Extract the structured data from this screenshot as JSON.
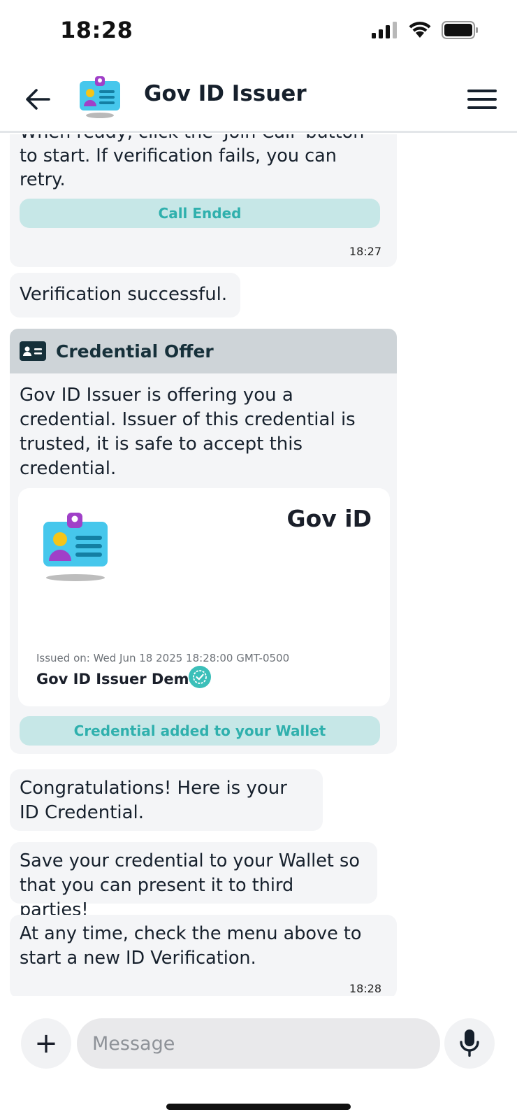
{
  "status_bar": {
    "time": "18:28",
    "icons": [
      "cellular-signal-icon",
      "wifi-icon",
      "battery-icon"
    ]
  },
  "header": {
    "title": "Gov ID Issuer",
    "back_icon": "arrow-left-icon",
    "menu_icon": "hamburger-menu-icon",
    "avatar_icon": "id-card-icon"
  },
  "messages": {
    "join_call": {
      "text": "When ready, click the 'Join Call' button to start. If verification fails, you can retry.",
      "status": "Call Ended",
      "time": "18:27"
    },
    "verification": {
      "text": "Verification successful."
    },
    "credential_offer": {
      "header": "Credential Offer",
      "text": "Gov ID Issuer is offering you a credential. Issuer of this credential is trusted, it is safe to accept this credential.",
      "card": {
        "name": "Gov iD",
        "issued_on": "Issued on: Wed Jun 18 2025 18:28:00 GMT-0500",
        "issuer": "Gov ID Issuer Demo"
      },
      "status": "Credential added to your Wallet"
    },
    "congrats": {
      "text": "Congratulations! Here is your ID Credential."
    },
    "save": {
      "text": "Save your credential to your Wallet so that you can present it to third parties!"
    },
    "anytime": {
      "text": "At any time, check the menu above to start a new ID Verification.",
      "time": "18:28"
    }
  },
  "composer": {
    "placeholder": "Message",
    "plus_label": "+"
  },
  "colors": {
    "accent": "#2fb0ad",
    "pill_bg": "#c6e7e7",
    "bubble_bg": "#f4f5f7",
    "offer_header_bg": "#ced4d8",
    "text": "#16202c"
  }
}
